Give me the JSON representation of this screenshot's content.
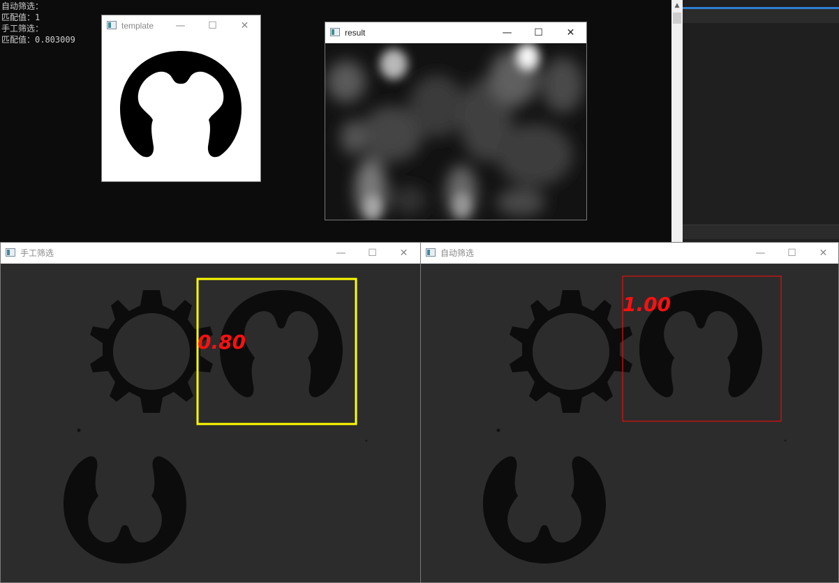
{
  "console": {
    "lines": [
      "自动筛选：",
      "匹配值：1",
      "手工筛选：",
      "匹配值：0.803009"
    ]
  },
  "windows": {
    "template": {
      "title": "template"
    },
    "result": {
      "title": "result"
    },
    "manual": {
      "title": "手工筛选",
      "score_label": "0.80",
      "box_color": "#ffff00"
    },
    "auto": {
      "title": "自动筛选",
      "score_label": "1.00",
      "box_color": "#ff0000"
    }
  },
  "controls": {
    "minimize": "—",
    "maximize": "☐",
    "close": "✕"
  },
  "colors": {
    "score_text": "#ff1010",
    "console_bg": "#0c0c0c",
    "ide_accent": "#2d7dd2"
  }
}
